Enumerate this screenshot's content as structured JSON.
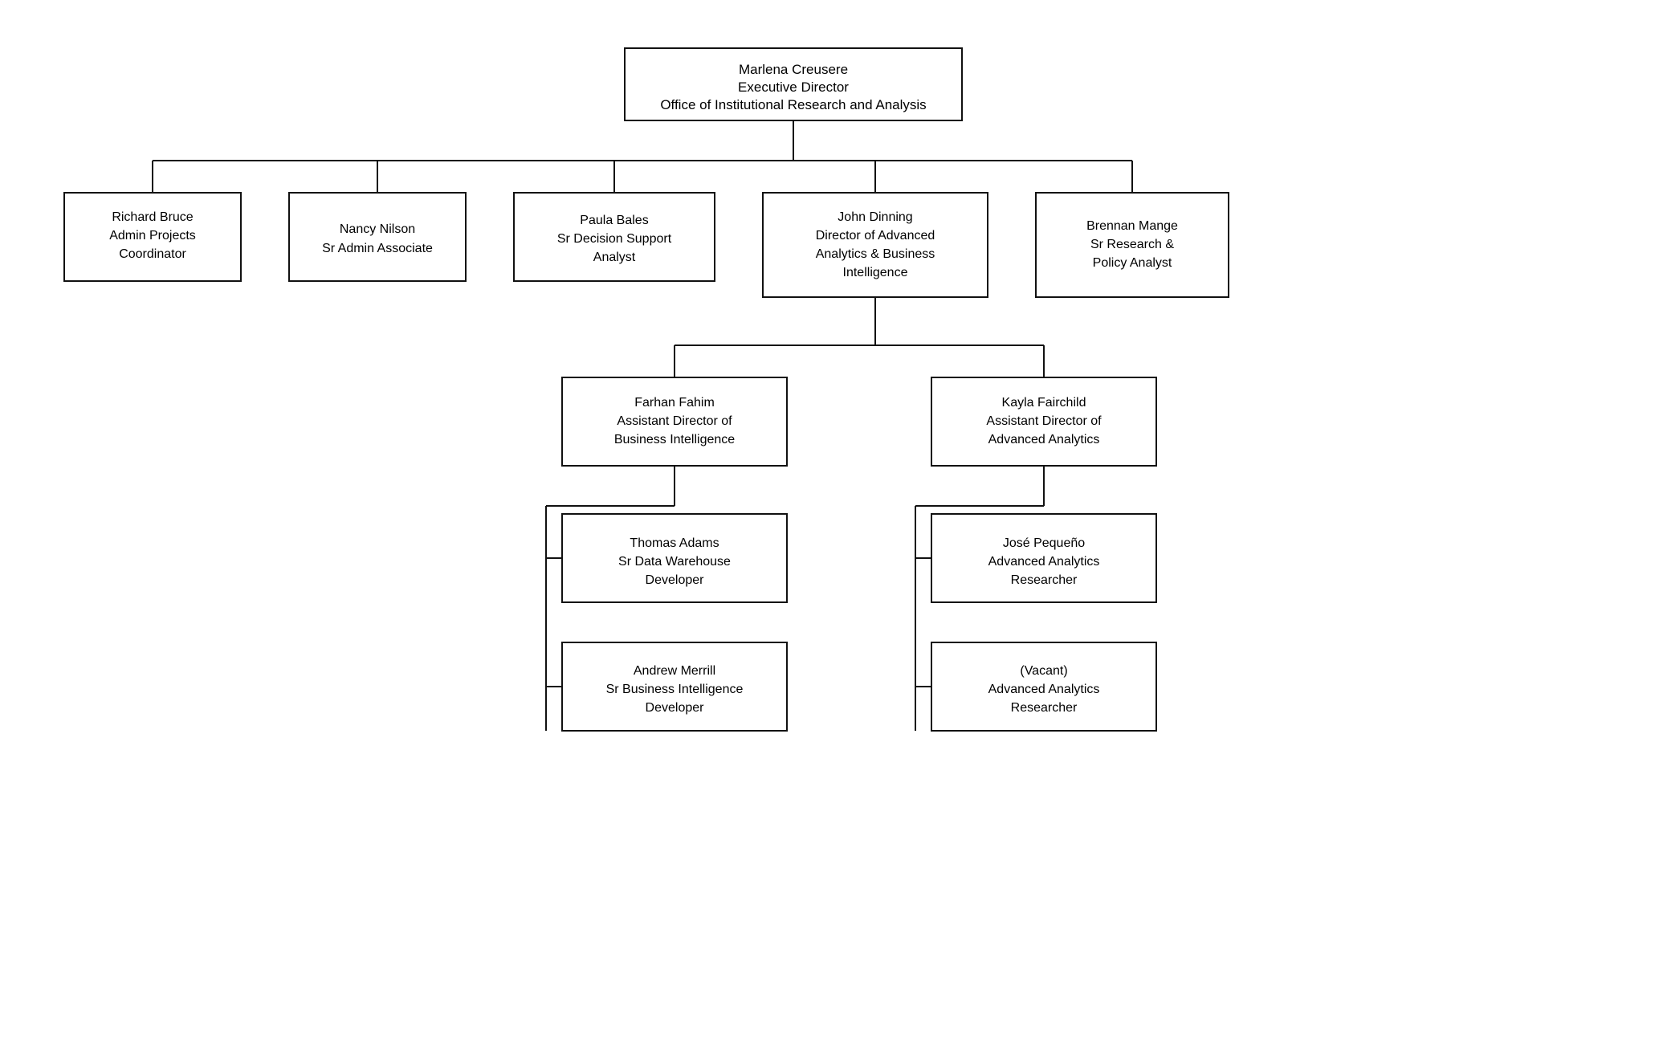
{
  "chart": {
    "root": {
      "name": "Marlena Creusere",
      "title1": "Executive Director",
      "title2": "Office of Institutional Research and Analysis"
    },
    "level1": [
      {
        "name": "Richard Bruce",
        "title": "Admin Projects Coordinator"
      },
      {
        "name": "Nancy Nilson",
        "title": "Sr Admin Associate"
      },
      {
        "name": "Paula Bales",
        "title": "Sr Decision Support Analyst"
      },
      {
        "name": "John Dinning",
        "title": "Director of Advanced Analytics & Business Intelligence"
      },
      {
        "name": "Brennan Mange",
        "title": "Sr Research & Policy Analyst"
      }
    ],
    "level2_under_john": [
      {
        "name": "Farhan Fahim",
        "title": "Assistant Director of Business Intelligence"
      },
      {
        "name": "Kayla Fairchild",
        "title": "Assistant Director of Advanced Analytics"
      }
    ],
    "level3_under_farhan": [
      {
        "name": "Thomas Adams",
        "title": "Sr Data Warehouse Developer"
      },
      {
        "name": "Andrew Merrill",
        "title": "Sr Business Intelligence Developer"
      }
    ],
    "level3_under_kayla": [
      {
        "name": "José Pequeño",
        "title": "Advanced Analytics Researcher"
      },
      {
        "name": "(Vacant)",
        "title": "Advanced Analytics Researcher"
      }
    ]
  }
}
